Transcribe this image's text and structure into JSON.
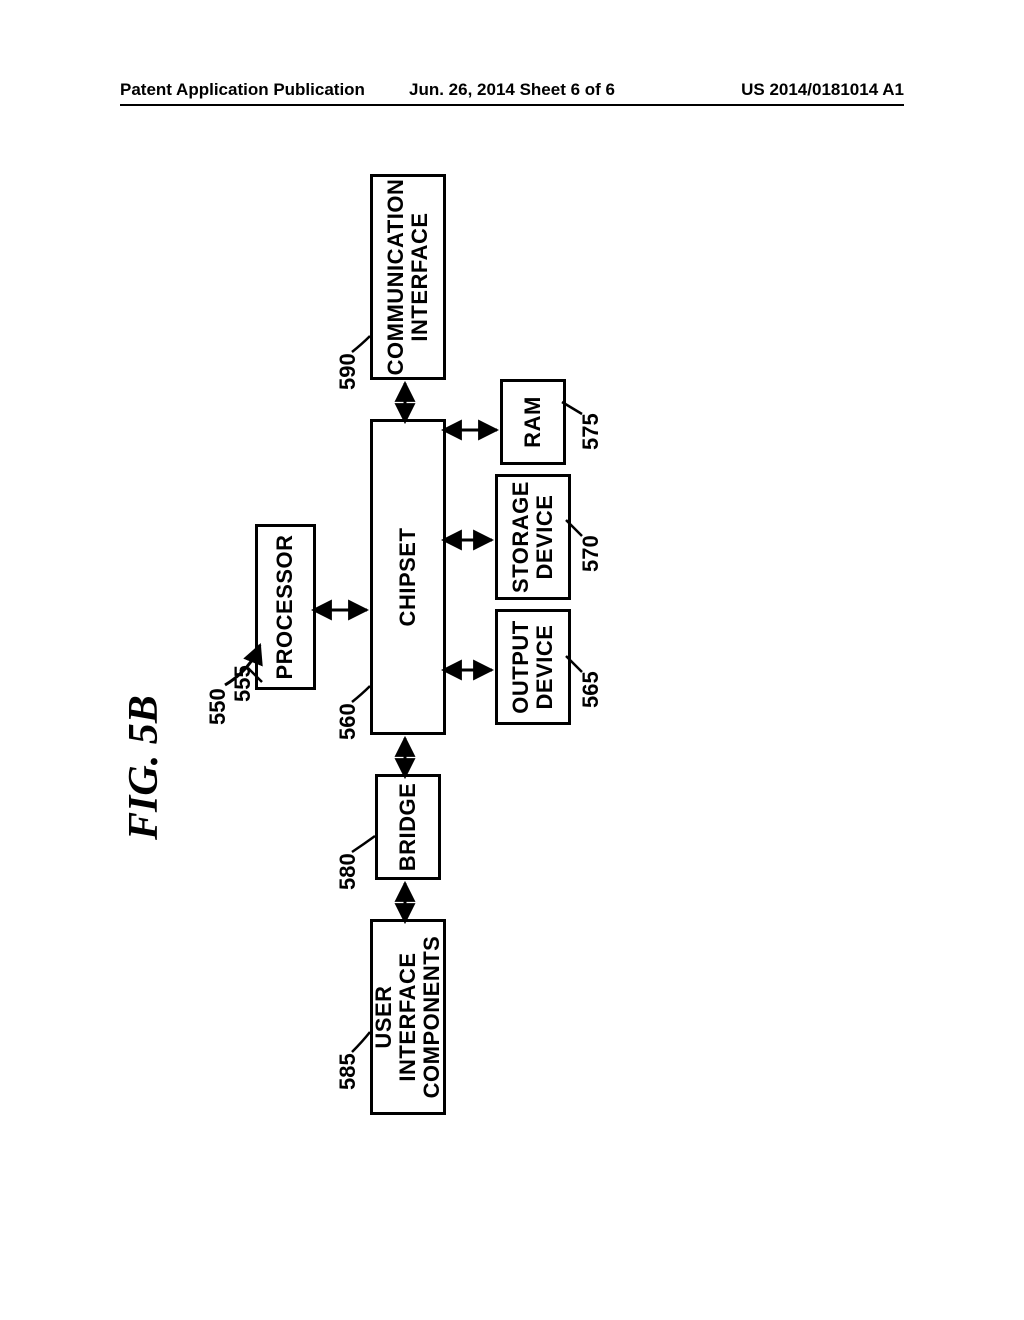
{
  "header": {
    "left": "Patent Application Publication",
    "middle": "Jun. 26, 2014  Sheet 6 of 6",
    "right": "US 2014/0181014 A1"
  },
  "figure": {
    "title": "FIG. 5B",
    "system_ref": "550"
  },
  "blocks": {
    "user_interface_components": {
      "label": "USER INTERFACE\nCOMPONENTS",
      "ref": "585"
    },
    "bridge": {
      "label": "BRIDGE",
      "ref": "580"
    },
    "processor": {
      "label": "PROCESSOR",
      "ref": "555"
    },
    "chipset": {
      "label": "CHIPSET",
      "ref": "560"
    },
    "output_device": {
      "label": "OUTPUT\nDEVICE",
      "ref": "565"
    },
    "storage_device": {
      "label": "STORAGE\nDEVICE",
      "ref": "570"
    },
    "ram": {
      "label": "RAM",
      "ref": "575"
    },
    "communication_interface": {
      "label": "COMMUNICATION\nINTERFACE",
      "ref": "590"
    }
  }
}
